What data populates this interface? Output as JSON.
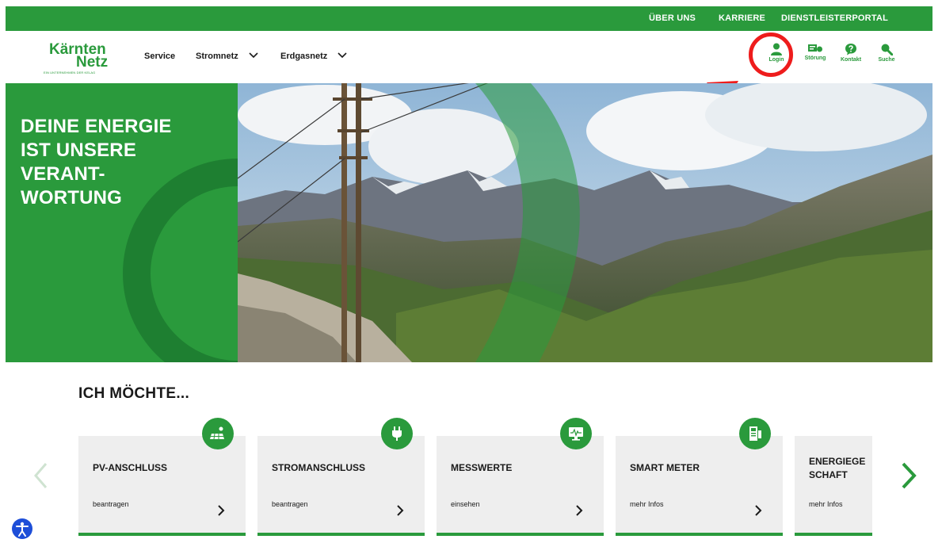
{
  "utility_nav": {
    "links": [
      "ÜBER UNS",
      "KARRIERE",
      "DIENSTLEISTERPORTAL"
    ]
  },
  "logo": {
    "line1": "Kärnten",
    "line2": "Netz",
    "tagline": "EIN UNTERNEHMEN DER KELAG"
  },
  "main_nav": {
    "items": [
      "Service",
      "Stromnetz",
      "Erdgasnetz"
    ]
  },
  "header_icons": [
    {
      "label": "Login",
      "icon": "user-icon"
    },
    {
      "label": "Störung",
      "icon": "fault-icon"
    },
    {
      "label": "Kontakt",
      "icon": "help-icon"
    },
    {
      "label": "Suche",
      "icon": "search-icon"
    }
  ],
  "hero": {
    "headline": [
      "DEINE ENERGIE",
      "IST UNSERE",
      "VERANT-",
      "WORTUNG"
    ]
  },
  "section": {
    "title": "ICH MÖCHTE..."
  },
  "cards": [
    {
      "title": "PV-ANSCHLUSS",
      "subtitle": "beantragen",
      "icon": "solar-panel-icon"
    },
    {
      "title": "STROMANSCHLUSS",
      "subtitle": "beantragen",
      "icon": "plug-icon"
    },
    {
      "title": "MESSWERTE",
      "subtitle": "einsehen",
      "icon": "monitor-icon"
    },
    {
      "title": "SMART METER",
      "subtitle": "mehr Infos",
      "icon": "smart-meter-icon"
    },
    {
      "title_line1": "ENERGIEGE",
      "title_line2": "SCHAFT",
      "subtitle": "mehr Infos"
    }
  ],
  "colors": {
    "brand_green": "#2a9a3c",
    "annotation_red": "#ee1c1c",
    "card_bg": "#eeeeee"
  }
}
